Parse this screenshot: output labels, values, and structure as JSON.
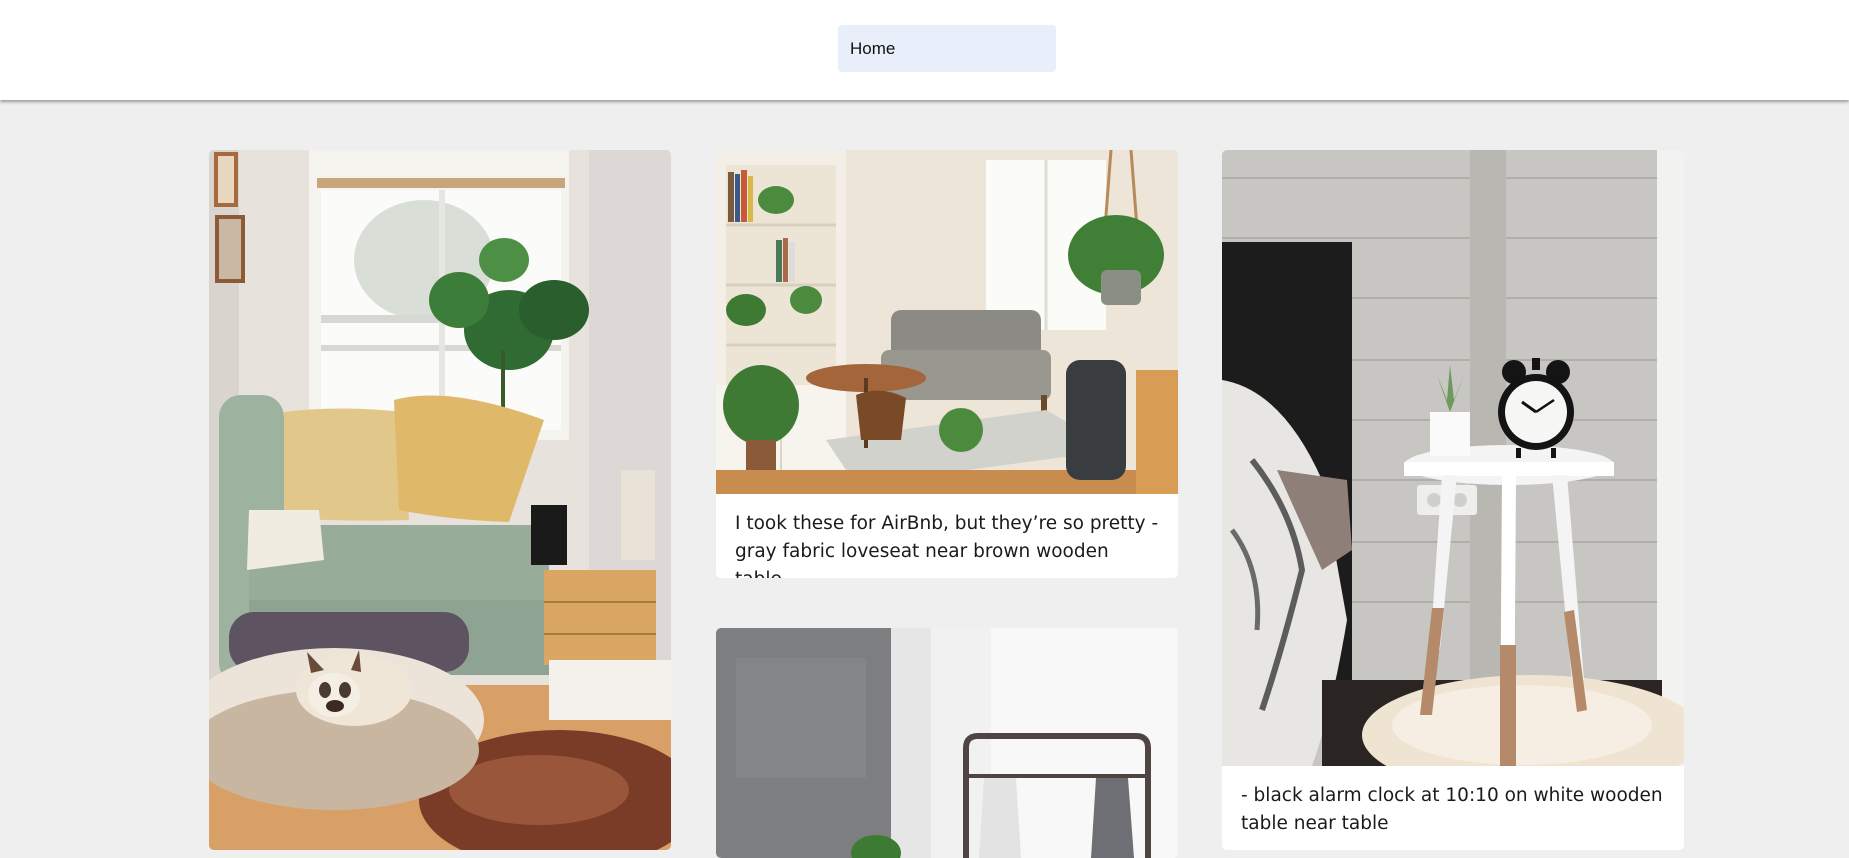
{
  "nav": {
    "selected": "Home"
  },
  "cards": [
    {
      "image_alt": "living room with green sofa, pillows, monstera plant and dog on cushion",
      "caption": ""
    },
    {
      "image_alt": "living room with bookshelf, gray loveseat and plants",
      "caption": "I took these for AirBnb, but they’re so pretty - gray fabric loveseat near brown wooden table"
    },
    {
      "image_alt": "clothing rack with hanging shirts near concrete wall",
      "caption": ""
    },
    {
      "image_alt": "black alarm clock on white wooden side table next to bed",
      "caption": "- black alarm clock at 10:10 on white wooden table near table"
    }
  ],
  "colors": {
    "page_bg": "#efefef",
    "nav_select_bg": "#e8effb",
    "card_bg": "#ffffff"
  }
}
